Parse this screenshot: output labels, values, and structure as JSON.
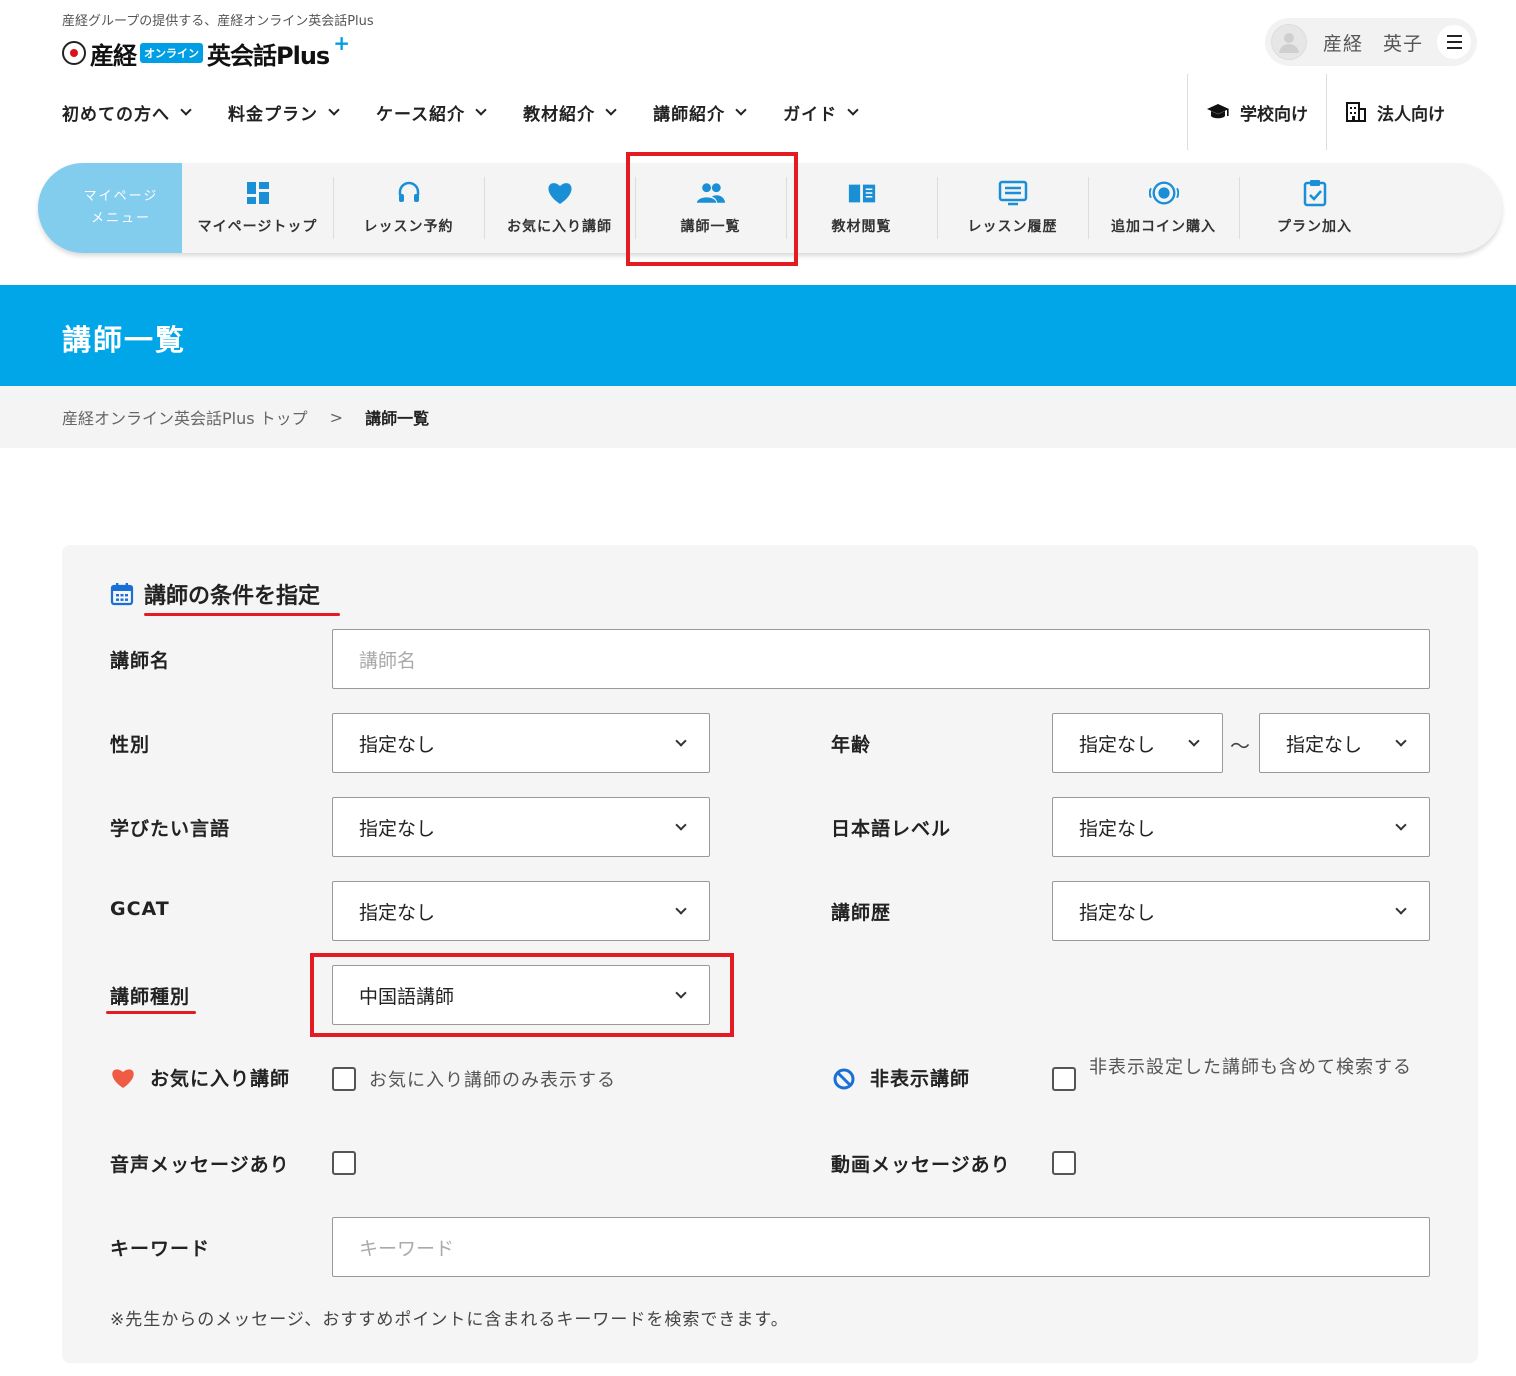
{
  "header": {
    "tagline": "産経グループの提供する、産経オンライン英会話Plus",
    "logo": {
      "part1": "産経",
      "badge": "オンライン",
      "part2": "英会話Plus",
      "plus": "+"
    },
    "user_name": "産経　英子"
  },
  "gnav": [
    {
      "label": "初めての方へ"
    },
    {
      "label": "料金プラン"
    },
    {
      "label": "ケース紹介"
    },
    {
      "label": "教材紹介"
    },
    {
      "label": "講師紹介"
    },
    {
      "label": "ガイド"
    }
  ],
  "side_links": [
    {
      "label": "学校向け",
      "icon": "graduation-cap-icon"
    },
    {
      "label": "法人向け",
      "icon": "building-icon"
    }
  ],
  "mypage_menu": {
    "label_line1": "マイページ",
    "label_line2": "メニュー",
    "items": [
      {
        "label": "マイページトップ",
        "icon": "dashboard-icon"
      },
      {
        "label": "レッスン予約",
        "icon": "headset-icon"
      },
      {
        "label": "お気に入り講師",
        "icon": "heart-icon"
      },
      {
        "label": "講師一覧",
        "icon": "people-icon"
      },
      {
        "label": "教材閲覧",
        "icon": "book-icon"
      },
      {
        "label": "レッスン履歴",
        "icon": "monitor-list-icon"
      },
      {
        "label": "追加コイン購入",
        "icon": "coin-icon"
      },
      {
        "label": "プラン加入",
        "icon": "clipboard-check-icon"
      }
    ],
    "highlighted": "講師一覧"
  },
  "page": {
    "title": "講師一覧",
    "breadcrumb": [
      "産経オンライン英会話Plus トップ",
      "講師一覧"
    ],
    "breadcrumb_sep": ">"
  },
  "search": {
    "section_title": "講師の条件を指定",
    "teacher_name": {
      "label": "講師名",
      "placeholder": "講師名"
    },
    "gender": {
      "label": "性別",
      "value": "指定なし"
    },
    "age": {
      "label": "年齢",
      "from": "指定なし",
      "to": "指定なし",
      "tilde": "〜"
    },
    "language": {
      "label": "学びたい言語",
      "value": "指定なし"
    },
    "japanese_level": {
      "label": "日本語レベル",
      "value": "指定なし"
    },
    "gcat": {
      "label": "GCAT",
      "value": "指定なし"
    },
    "experience": {
      "label": "講師歴",
      "value": "指定なし"
    },
    "teacher_type": {
      "label": "講師種別",
      "value": "中国語講師"
    },
    "favorite": {
      "label": "お気に入り講師",
      "checkbox_text": "お気に入り講師のみ表示する",
      "checked": false
    },
    "hidden": {
      "label": "非表示講師",
      "checkbox_text": "非表示設定した講師も含めて検索する",
      "checked": false
    },
    "voice_message": {
      "label": "音声メッセージあり",
      "checked": false
    },
    "video_message": {
      "label": "動画メッセージあり",
      "checked": false
    },
    "keyword": {
      "label": "キーワード",
      "placeholder": "キーワード"
    },
    "note": "※先生からのメッセージ、おすすめポイントに含まれるキーワードを検索できます。"
  },
  "colors": {
    "accent": "#00a6e8",
    "highlight": "#e31c24",
    "menu_label_bg": "#82ccee",
    "icon_blue": "#1a8fd6"
  }
}
